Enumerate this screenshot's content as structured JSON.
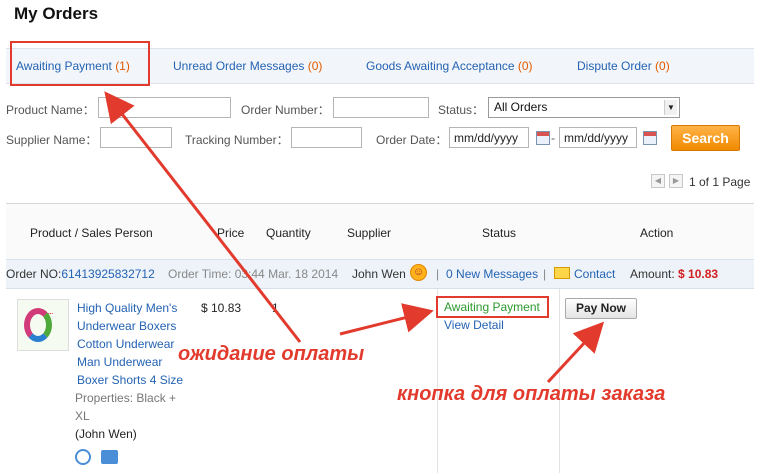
{
  "page": {
    "title": "My Orders"
  },
  "tabs": [
    {
      "label": "Awaiting Payment",
      "count": "(1)"
    },
    {
      "label": "Unread Order Messages",
      "count": "(0)"
    },
    {
      "label": "Goods Awaiting Acceptance",
      "count": "(0)"
    },
    {
      "label": "Dispute Order",
      "count": "(0)"
    }
  ],
  "filters": {
    "product_name_label": "Product Name：",
    "order_number_label": "Order Number：",
    "status_label": "Status：",
    "status_value": "All Orders",
    "supplier_name_label": "Supplier Name：",
    "tracking_number_label": "Tracking Number：",
    "order_date_label": "Order Date：",
    "date_from": "mm/dd/yyyy",
    "date_sep": "-",
    "date_to": "mm/dd/yyyy",
    "search_label": "Search"
  },
  "pager": {
    "text": "1 of 1 Page"
  },
  "table_headers": [
    "Product / Sales Person",
    "Price",
    "Quantity",
    "Supplier",
    "Status",
    "Action"
  ],
  "order": {
    "order_no_label": "Order NO:",
    "order_no": "61413925832712",
    "order_time_label": "Order Time:",
    "order_time": "03:44 Mar. 18 2014",
    "supplier": "John Wen",
    "messages_count": "0",
    "messages_label": "New Messages",
    "sep": "|",
    "contact_label": "Contact",
    "amount_label": "Amount:",
    "amount": "$ 10.83"
  },
  "item": {
    "title_lines": [
      "High Quality Men's",
      "Underwear Boxers",
      "Cotton Underwear",
      "Man Underwear",
      "Boxer Shorts 4 Size"
    ],
    "properties_line1": "Properties: Black  +",
    "properties_line2": "XL",
    "sales_person": "(John Wen)",
    "price": "$ 10.83",
    "quantity": "1",
    "status": "Awaiting Payment",
    "view_detail": "View Detail",
    "pay_now": "Pay Now",
    "thumb_text": "..."
  },
  "annotations": {
    "awaiting_note": "ожидание оплаты",
    "pay_note": "кнопка для оплаты заказа"
  },
  "colors": {
    "link": "#2463b3",
    "count": "#e05a00",
    "annotation_red": "#e23b2e",
    "search_orange": "#f08a00",
    "status_green": "#2d9a2d"
  }
}
